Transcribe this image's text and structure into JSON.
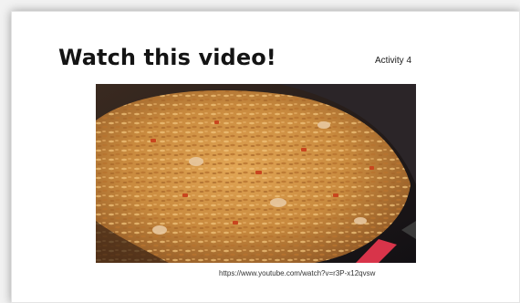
{
  "slide": {
    "title": "Watch this video!",
    "activity_label": "Activity 4",
    "video_url": "https://www.youtube.com/watch?v=r3P-x12qvsw"
  },
  "video": {
    "thumbnail_icon": "fried-rice-wok-image",
    "colors": {
      "wok_dark": "#1c1a1c",
      "rice_base": "#c98a3e",
      "rice_highlight": "#e6b267",
      "pepper_red": "#c8461e",
      "handle_red": "#d8344a"
    }
  }
}
